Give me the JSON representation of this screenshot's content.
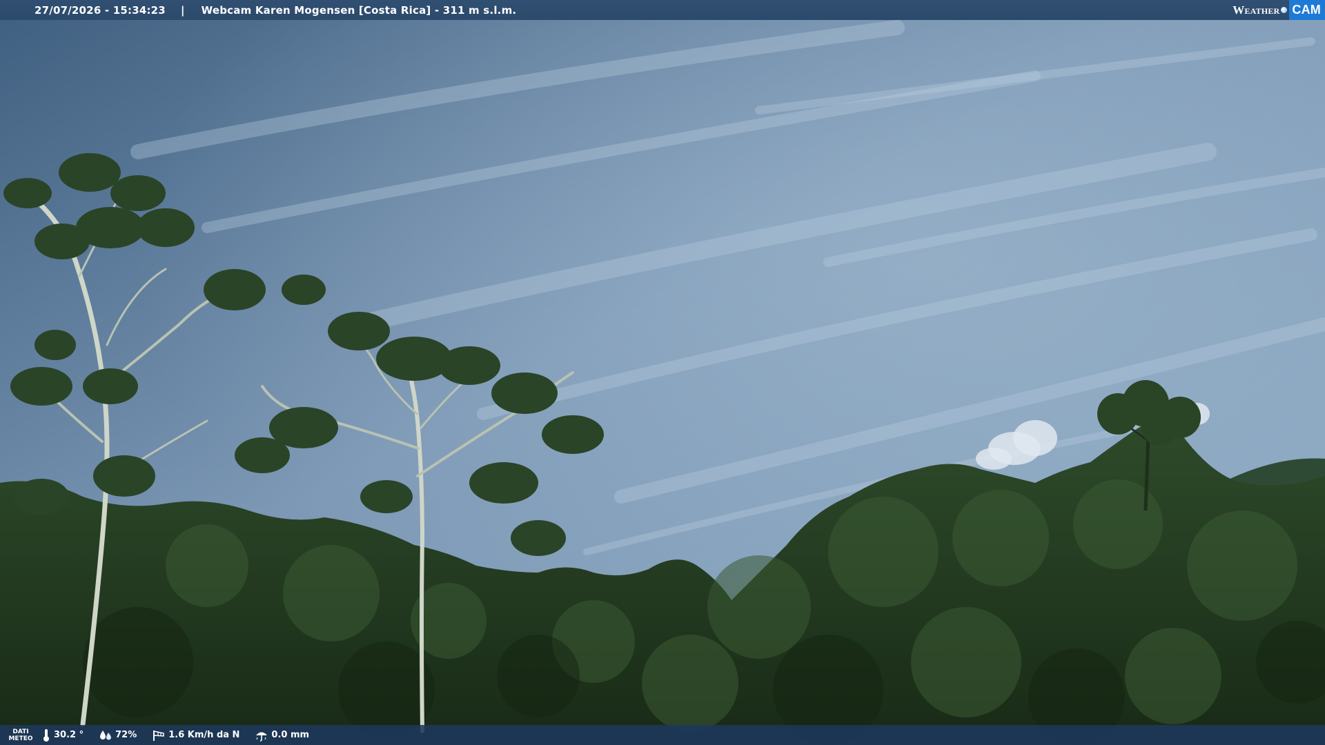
{
  "header": {
    "datetime": "27/07/2026 - 15:34:23",
    "separator": "|",
    "title": "Webcam Karen Mogensen [Costa Rica]  - 311 m s.l.m."
  },
  "logo": {
    "text_part1": "Weather",
    "text_part2": "CAM",
    "accent_color": "#1e7ad6"
  },
  "footer": {
    "label_line1": "DATI",
    "label_line2": "METEO",
    "temperature": "30.2 °",
    "humidity": "72%",
    "wind": "1.6 Km/h da N",
    "rain": "0.0 mm",
    "icons": {
      "temperature": "thermometer-icon",
      "humidity": "humidity-drops-icon",
      "wind": "wind-sock-icon",
      "rain": "rain-umbrella-icon"
    }
  }
}
